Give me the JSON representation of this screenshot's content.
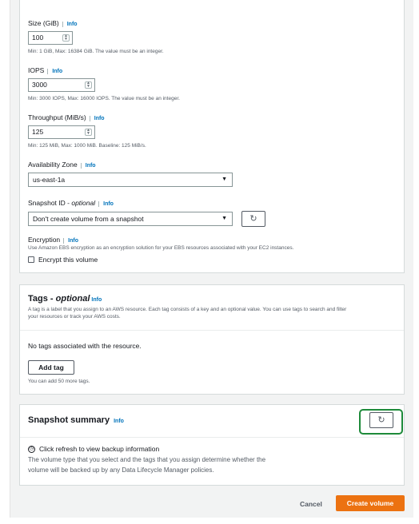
{
  "volume": {
    "size": {
      "label": "Size (GiB)",
      "info": "Info",
      "value": "100",
      "hint": "Min: 1 GiB, Max: 16384 GiB. The value must be an integer."
    },
    "iops": {
      "label": "IOPS",
      "info": "Info",
      "value": "3000",
      "hint": "Min: 3000 IOPS, Max: 16000 IOPS. The value must be an integer."
    },
    "throughput": {
      "label": "Throughput (MiB/s)",
      "info": "Info",
      "value": "125",
      "hint": "Min: 125 MiB, Max: 1000 MiB. Baseline: 125 MiB/s."
    },
    "availability_zone": {
      "label": "Availability Zone",
      "info": "Info",
      "value": "us-east-1a"
    },
    "snapshot_id": {
      "label": "Snapshot ID - ",
      "label_optional": "optional",
      "info": "Info",
      "value": "Don't create volume from a snapshot"
    },
    "encryption": {
      "label": "Encryption",
      "info": "Info",
      "description": "Use Amazon EBS encryption as an encryption solution for your EBS resources associated with your EC2 instances.",
      "checkbox_label": "Encrypt this volume"
    }
  },
  "tags": {
    "title": "Tags - ",
    "title_optional": "optional",
    "info": "Info",
    "description_line1": "A tag is a label that you assign to an AWS resource. Each tag consists of a key and an optional value. You can use tags to search and filter",
    "description_line2": "your resources or track your AWS costs.",
    "empty_text": "No tags associated with the resource.",
    "add_button": "Add tag",
    "limit_hint": "You can add 50 more tags."
  },
  "snapshot_summary": {
    "title": "Snapshot summary",
    "info": "Info",
    "refresh_message": "Click refresh to view backup information",
    "description_line1": "The volume type that you select and the tags that you assign determine whether the",
    "description_line2": "volume will be backed up by any Data Lifecycle Manager policies."
  },
  "footer": {
    "cancel_label": "Cancel",
    "create_label": "Create volume"
  },
  "colors": {
    "primary": "#ec7211",
    "link": "#0073bb",
    "highlight": "#1d8a3a"
  }
}
